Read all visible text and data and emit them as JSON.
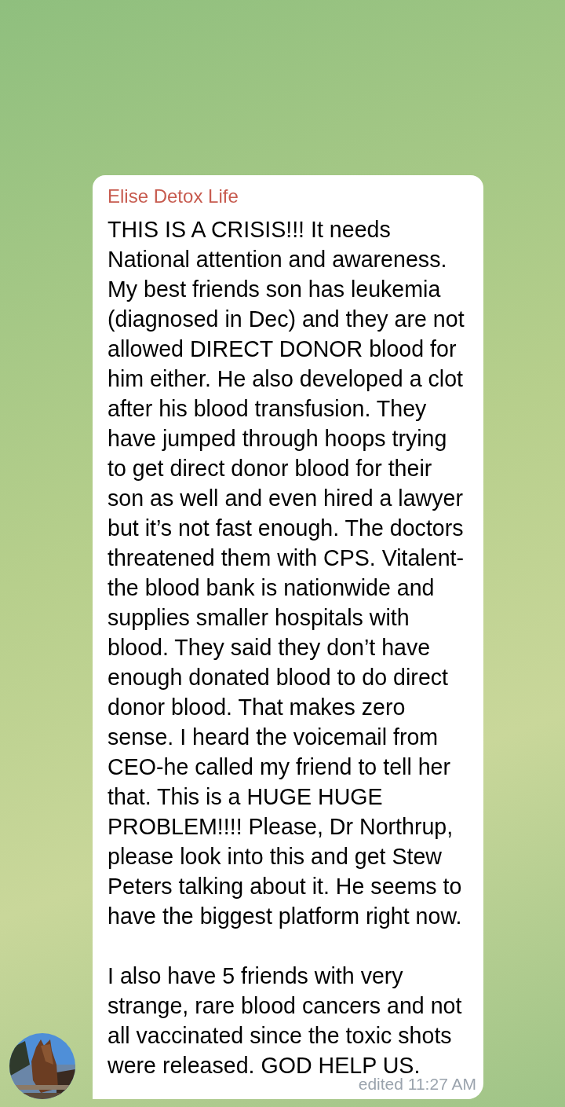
{
  "message": {
    "sender": "Elise Detox Life",
    "paragraphs": [
      "THIS IS A CRISIS!!! It needs National attention and awareness. My best friends son has leukemia (diagnosed in Dec) and they are not allowed DIRECT DONOR blood for him either. He also developed a clot after his blood transfusion. They have jumped through hoops trying to get direct donor blood for their son as well and even hired a lawyer but it’s not fast enough. The doctors threatened them with CPS. Vitalent-the blood bank is nationwide and supplies smaller hospitals with blood. They said they don’t have enough donated blood to do direct donor blood. That makes zero sense. I heard the voicemail from CEO-he called my friend to tell her that. This is a HUGE HUGE PROBLEM!!!! Please, Dr Northrup, please look into this and get Stew Peters talking about it. He seems to have the biggest platform right now.",
      "I also have 5 friends with very strange, rare blood cancers and not all vaccinated since the toxic shots were released. GOD HELP US."
    ],
    "time": "edited 11:27 AM"
  }
}
